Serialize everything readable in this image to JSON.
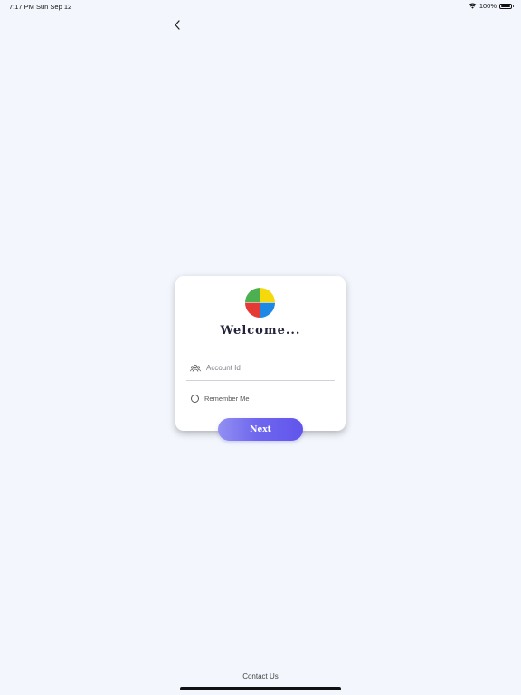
{
  "status_bar": {
    "time": "7:17 PM",
    "date": "Sun Sep 12",
    "battery": "100%",
    "icons": [
      "wifi-icon",
      "battery-icon"
    ]
  },
  "nav": {
    "back_icon": "chevron-left-icon"
  },
  "login_card": {
    "logo_colors": [
      "#4caf50",
      "#f5d90c",
      "#e53935",
      "#1e88e5"
    ],
    "welcome_text": "Welcome...",
    "account_field": {
      "icon": "users-icon",
      "placeholder": "Account Id",
      "value": ""
    },
    "remember_me": {
      "label": "Remember Me",
      "checked": false
    }
  },
  "next_button": {
    "label": "Next",
    "gradient": [
      "#9290f2",
      "#6155ec"
    ]
  },
  "footer": {
    "contact_label": "Contact Us"
  }
}
